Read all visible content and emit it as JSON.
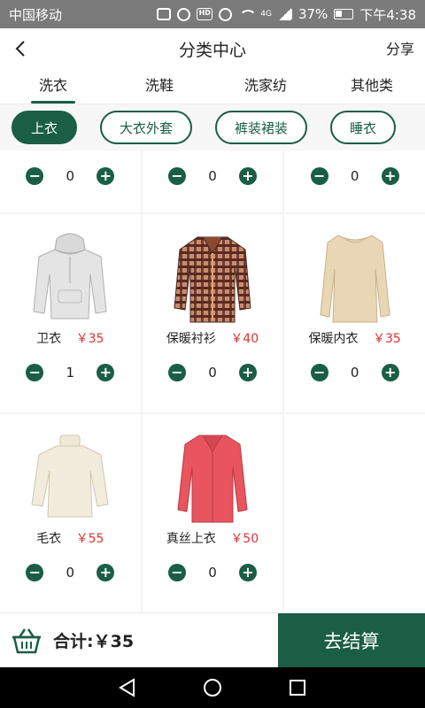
{
  "status_bar": {
    "carrier": "中国移动",
    "network": "4G",
    "battery": "37%",
    "time": "下午4:38"
  },
  "header": {
    "title": "分类中心",
    "share_label": "分享"
  },
  "category_tabs": [
    "洗衣",
    "洗鞋",
    "洗家纺",
    "其他类"
  ],
  "active_category": "洗衣",
  "subcategories": [
    "上衣",
    "大衣外套",
    "裤装裙装",
    "睡衣"
  ],
  "active_subcategory": "上衣",
  "top_row_quantities": [
    "0",
    "0",
    "0"
  ],
  "products": [
    {
      "name": "卫衣",
      "price": "￥35",
      "quantity": "1"
    },
    {
      "name": "保暖衬衫",
      "price": "￥40",
      "quantity": "0"
    },
    {
      "name": "保暖内衣",
      "price": "￥35",
      "quantity": "0"
    },
    {
      "name": "毛衣",
      "price": "￥55",
      "quantity": "0"
    },
    {
      "name": "真丝上衣",
      "price": "￥50",
      "quantity": "0"
    }
  ],
  "stepper_symbols": {
    "minus": "−",
    "plus": "+"
  },
  "cart": {
    "total_label": "合计:￥35",
    "checkout_label": "去结算"
  },
  "colors": {
    "accent": "#1a5e45",
    "price": "#dd3333"
  }
}
